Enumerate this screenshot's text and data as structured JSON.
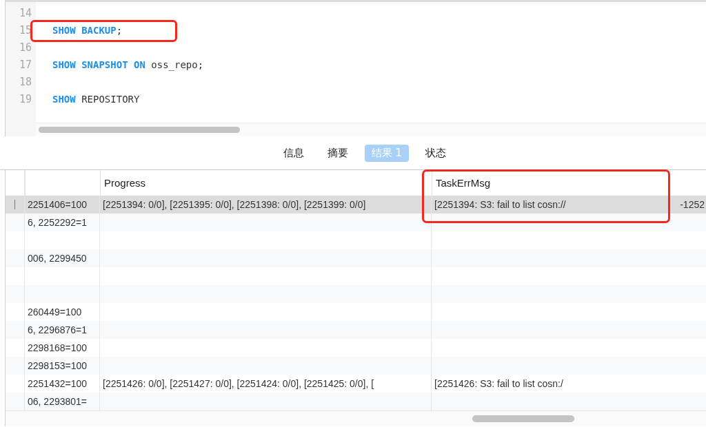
{
  "editor": {
    "lines": [
      {
        "number": "14"
      },
      {
        "number": "15",
        "highlighted": true,
        "tokens": [
          {
            "text": "SHOW BACKUP",
            "kind": "keyword"
          },
          {
            "text": ";",
            "kind": "plain"
          }
        ]
      },
      {
        "number": "16"
      },
      {
        "number": "17",
        "tokens": [
          {
            "text": "SHOW SNAPSHOT ON",
            "kind": "keyword"
          },
          {
            "text": " oss_repo;",
            "kind": "plain"
          }
        ]
      },
      {
        "number": "18"
      },
      {
        "number": "19",
        "tokens": [
          {
            "text": "SHOW",
            "kind": "keyword"
          },
          {
            "text": " REPOSITORY",
            "kind": "plain"
          }
        ]
      }
    ]
  },
  "tabs": [
    {
      "label": "信息",
      "selected": false
    },
    {
      "label": "摘要",
      "selected": false
    },
    {
      "label": "结果 1",
      "selected": true
    },
    {
      "label": "状态",
      "selected": false
    }
  ],
  "table": {
    "columns": [
      {
        "highlighted": false
      },
      {
        "label": "Progress",
        "highlighted": false
      },
      {
        "label": "TaskErrMsg",
        "highlighted": true
      }
    ],
    "rows": [
      {
        "selected": true,
        "column_1": "2251406=100",
        "progress": "[2251394: 0/0], [2251395: 0/0], [2251398: 0/0], [2251399: 0/0]",
        "task_err_msg": "[2251394: S3: fail to list cosn://",
        "task_err_msg_tail": "-1252"
      },
      {
        "selected": false,
        "column_1": "6, 2252292=1"
      },
      {
        "selected": false
      },
      {
        "selected": false,
        "column_1": "006, 2299450"
      },
      {
        "selected": false
      },
      {
        "selected": false
      },
      {
        "selected": false,
        "column_1": "260449=100"
      },
      {
        "selected": false,
        "column_1": "6, 2296876=1"
      },
      {
        "selected": false,
        "column_1": "2298168=100"
      },
      {
        "selected": false,
        "column_1": "2298153=100"
      },
      {
        "selected": false,
        "column_1": "2251432=100",
        "progress": "[2251426: 0/0], [2251427: 0/0], [2251424: 0/0], [2251425: 0/0], [",
        "task_err_msg": "[2251426: S3: fail to list cosn:/"
      },
      {
        "selected": false,
        "column_1": "06, 2293801="
      }
    ]
  }
}
